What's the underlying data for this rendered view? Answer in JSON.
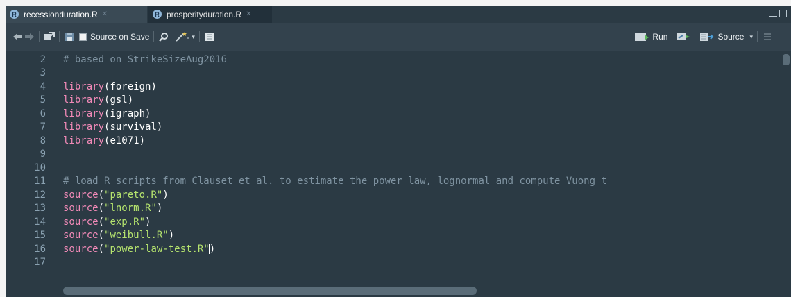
{
  "tabs": [
    {
      "label": "recessionduration.R",
      "icon": "r-file-icon",
      "active": true
    },
    {
      "label": "prosperityduration.R",
      "icon": "r-file-icon",
      "active": false
    }
  ],
  "toolbar": {
    "source_on_save_label": "Source on Save",
    "run_label": "Run",
    "source_label": "Source"
  },
  "editor": {
    "line_numbers": [
      "2",
      "3",
      "4",
      "5",
      "6",
      "7",
      "8",
      "9",
      "10",
      "11",
      "12",
      "13",
      "14",
      "15",
      "16",
      "17"
    ],
    "lines": [
      {
        "comment": "# based on StrikeSizeAug2016"
      },
      {},
      {
        "fn": "library",
        "arg": "foreign"
      },
      {
        "fn": "library",
        "arg": "gsl"
      },
      {
        "fn": "library",
        "arg": "igraph"
      },
      {
        "fn": "library",
        "arg": "survival"
      },
      {
        "fn": "library",
        "arg": "e1071"
      },
      {},
      {},
      {
        "comment": "# load R scripts from Clauset et al. to estimate the power law, lognormal and compute Vuong t"
      },
      {
        "fn": "source",
        "string": "\"pareto.R\""
      },
      {
        "fn": "source",
        "string": "\"lnorm.R\""
      },
      {
        "fn": "source",
        "string": "\"exp.R\""
      },
      {
        "fn": "source",
        "string": "\"weibull.R\""
      },
      {
        "fn": "source",
        "string": "\"power-law-test.R\"",
        "cursor": true
      },
      {}
    ]
  }
}
